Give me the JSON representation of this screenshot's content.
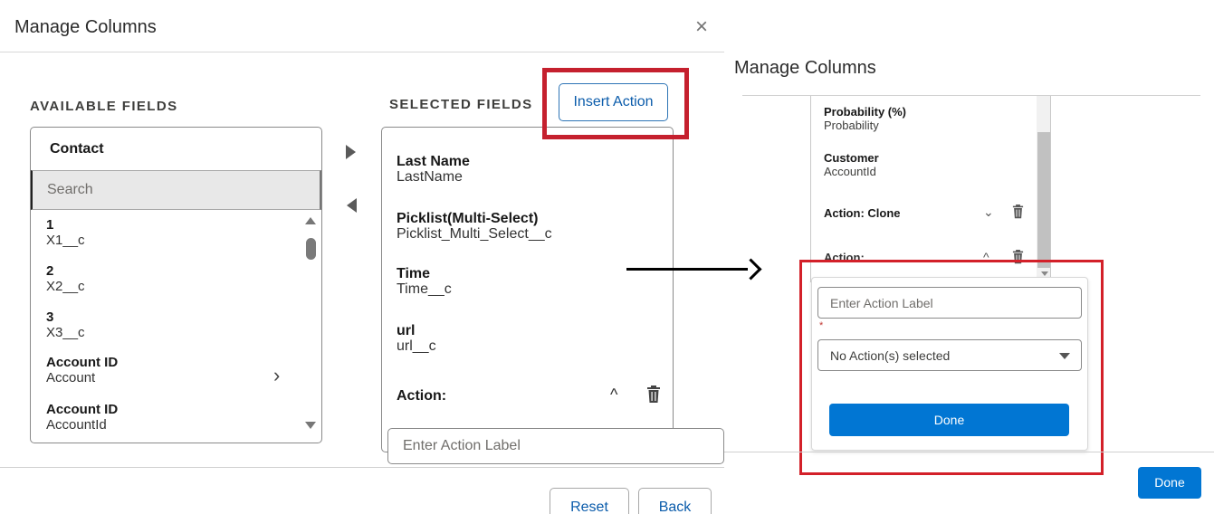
{
  "colors": {
    "highlight": "#c5202e",
    "primary_button": "#0176d3",
    "link_text": "#0b5cab",
    "search_background": "#e8e8e8"
  },
  "left_panel": {
    "title": "Manage Columns",
    "close_icon": "close-icon",
    "close_glyph": "×",
    "available": {
      "heading": "AVAILABLE FIELDS",
      "object_name": "Contact",
      "search_placeholder": "Search",
      "items": [
        {
          "label": "1",
          "api": "X1__c"
        },
        {
          "label": "2",
          "api": "X2__c"
        },
        {
          "label": "3",
          "api": "X3__c"
        },
        {
          "label": "Account ID",
          "api": "Account",
          "has_children": true
        },
        {
          "label": "Account ID",
          "api": "AccountId"
        }
      ],
      "chevron_glyph": "›"
    },
    "selected": {
      "heading": "SELECTED FIELDS",
      "insert_action_label": "Insert Action",
      "items": [
        {
          "label": "Last Name",
          "api": "LastName"
        },
        {
          "label": "Picklist(Multi-Select)",
          "api": "Picklist_Multi_Select__c"
        },
        {
          "label": "Time",
          "api": "Time__c"
        },
        {
          "label": "url",
          "api": "url__c"
        }
      ],
      "action_row": {
        "label": "Action:",
        "expand_icon": "chevron-up-icon",
        "expand_glyph": "^",
        "delete_icon": "trash-icon"
      }
    },
    "action_label_placeholder": "Enter Action Label",
    "footer": {
      "reset_label": "Reset",
      "back_label": "Back"
    }
  },
  "right_panel": {
    "title": "Manage Columns",
    "items": [
      {
        "label": "Probability (%)",
        "api": "Probability"
      },
      {
        "label": "Customer",
        "api": "AccountId"
      }
    ],
    "clone_row": {
      "label": "Action: Clone",
      "toggle_icon": "chevron-down-icon",
      "toggle_glyph": "⌄",
      "delete_icon": "trash-icon"
    },
    "action_row": {
      "label": "Action:",
      "toggle_icon": "chevron-up-icon",
      "toggle_glyph": "^",
      "delete_icon": "trash-icon"
    },
    "popover": {
      "label_placeholder": "Enter Action Label",
      "required_mark": "*",
      "select_value": "No Action(s) selected",
      "done_label": "Done"
    },
    "footer_done_label": "Done"
  }
}
